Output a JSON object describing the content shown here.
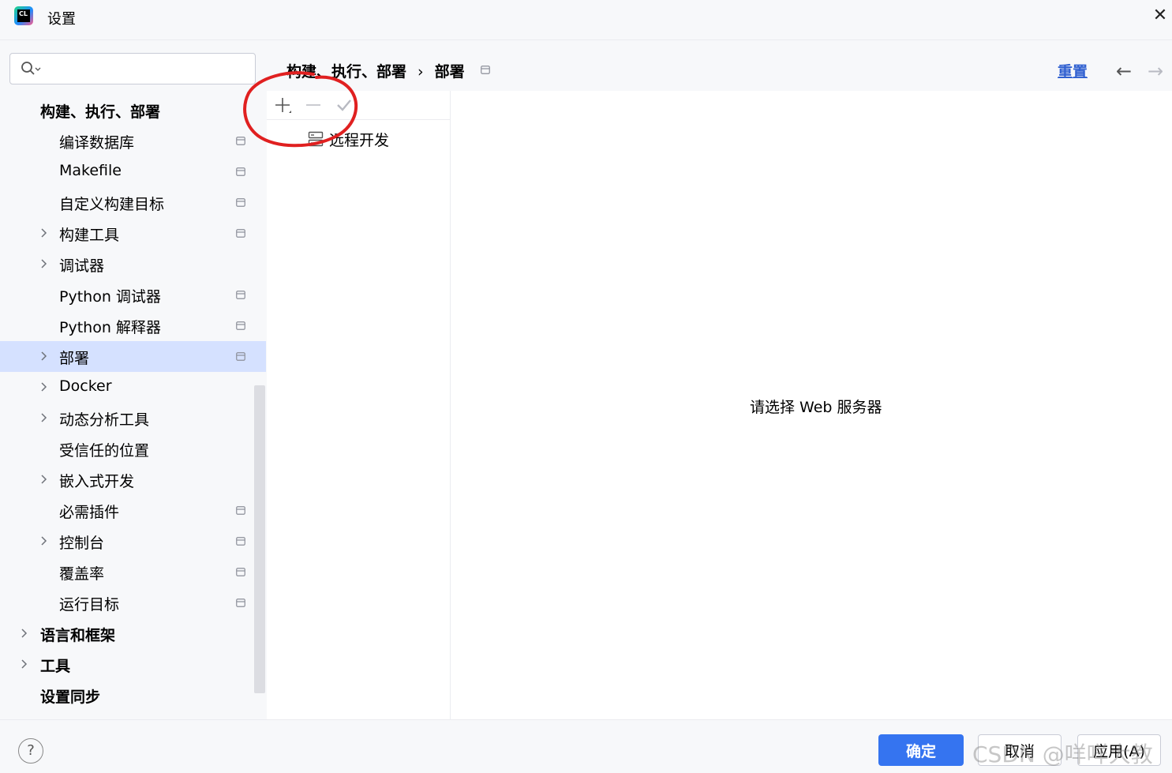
{
  "window": {
    "icon_text": "CL",
    "title": "设置"
  },
  "search": {
    "value": "",
    "placeholder": ""
  },
  "sidebar": {
    "items": [
      {
        "label": "构建、执行、部署",
        "level": 0,
        "bold": true,
        "expandable": false,
        "project_icon": false,
        "selected": false
      },
      {
        "label": "编译数据库",
        "level": 1,
        "bold": false,
        "expandable": false,
        "project_icon": true,
        "selected": false
      },
      {
        "label": "Makefile",
        "level": 1,
        "bold": false,
        "expandable": false,
        "project_icon": true,
        "selected": false
      },
      {
        "label": "自定义构建目标",
        "level": 1,
        "bold": false,
        "expandable": false,
        "project_icon": true,
        "selected": false
      },
      {
        "label": "构建工具",
        "level": 1,
        "bold": false,
        "expandable": true,
        "project_icon": true,
        "selected": false
      },
      {
        "label": "调试器",
        "level": 1,
        "bold": false,
        "expandable": true,
        "project_icon": false,
        "selected": false
      },
      {
        "label": "Python 调试器",
        "level": 1,
        "bold": false,
        "expandable": false,
        "project_icon": true,
        "selected": false
      },
      {
        "label": "Python 解释器",
        "level": 1,
        "bold": false,
        "expandable": false,
        "project_icon": true,
        "selected": false
      },
      {
        "label": "部署",
        "level": 1,
        "bold": false,
        "expandable": true,
        "project_icon": true,
        "selected": true
      },
      {
        "label": "Docker",
        "level": 1,
        "bold": false,
        "expandable": true,
        "project_icon": false,
        "selected": false
      },
      {
        "label": "动态分析工具",
        "level": 1,
        "bold": false,
        "expandable": true,
        "project_icon": false,
        "selected": false
      },
      {
        "label": "受信任的位置",
        "level": 1,
        "bold": false,
        "expandable": false,
        "project_icon": false,
        "selected": false
      },
      {
        "label": "嵌入式开发",
        "level": 1,
        "bold": false,
        "expandable": true,
        "project_icon": false,
        "selected": false
      },
      {
        "label": "必需插件",
        "level": 1,
        "bold": false,
        "expandable": false,
        "project_icon": true,
        "selected": false
      },
      {
        "label": "控制台",
        "level": 1,
        "bold": false,
        "expandable": true,
        "project_icon": true,
        "selected": false
      },
      {
        "label": "覆盖率",
        "level": 1,
        "bold": false,
        "expandable": false,
        "project_icon": true,
        "selected": false
      },
      {
        "label": "运行目标",
        "level": 1,
        "bold": false,
        "expandable": false,
        "project_icon": true,
        "selected": false
      },
      {
        "label": "语言和框架",
        "level": 0,
        "bold": true,
        "expandable": true,
        "project_icon": false,
        "selected": false
      },
      {
        "label": "工具",
        "level": 0,
        "bold": true,
        "expandable": true,
        "project_icon": false,
        "selected": false
      },
      {
        "label": "设置同步",
        "level": 0,
        "bold": true,
        "expandable": false,
        "project_icon": false,
        "selected": false
      }
    ]
  },
  "breadcrumb": {
    "parent": "构建、执行、部署",
    "separator": "›",
    "current": "部署"
  },
  "header": {
    "reset_label": "重置",
    "back_glyph": "←",
    "forward_glyph": "→"
  },
  "server_list": {
    "toolbar": [
      "add-icon",
      "remove-icon",
      "check-icon"
    ],
    "items": [
      {
        "label": "远程开发",
        "icon": "server-icon"
      }
    ]
  },
  "detail": {
    "empty_message": "请选择 Web 服务器"
  },
  "footer": {
    "help_label": "?",
    "ok_label": "确定",
    "cancel_label": "取消",
    "apply_label": "应用(A)",
    "watermark": "CSDN @咩咩大教"
  },
  "colors": {
    "accent": "#3574f0",
    "selection": "#d5e1ff",
    "link": "#2f5fd0",
    "annotation": "#e02020"
  }
}
